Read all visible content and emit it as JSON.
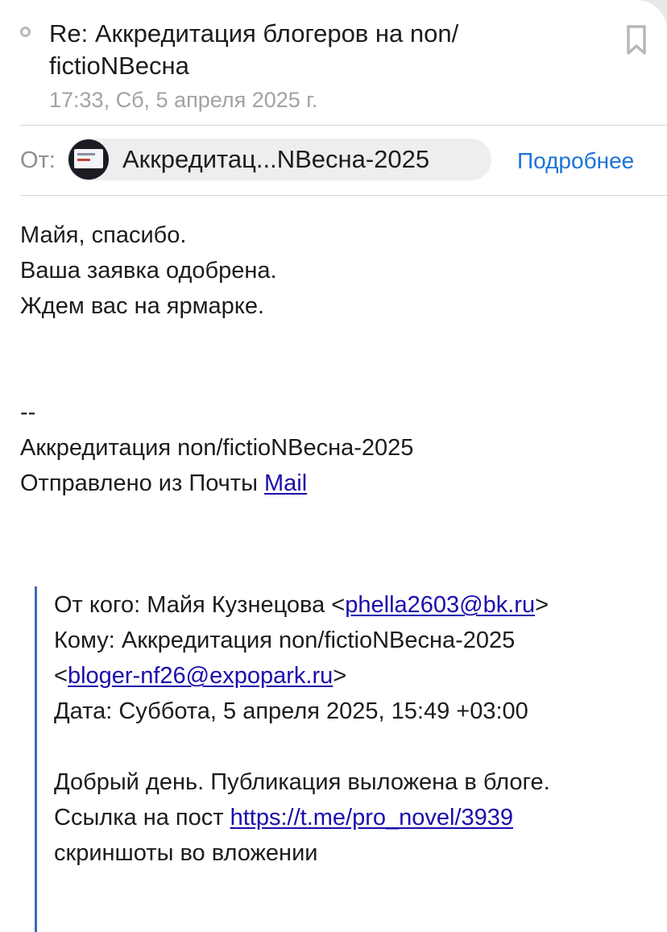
{
  "header": {
    "subject": "Re: Аккредитация блогеров на non/ fictioNВесна",
    "date": "17:33, Сб, 5 апреля 2025 г."
  },
  "from_row": {
    "label": "От:",
    "sender_name": "Аккредитац...NВесна-2025",
    "details_link": "Подробнее"
  },
  "body": {
    "lines": [
      "Майя, спасибо.",
      "Ваша заявка одобрена.",
      "Ждем вас на ярмарке."
    ],
    "signature": {
      "dash": "--",
      "name": "Аккредитация non/fictioNВесна-2025",
      "sent_prefix": "Отправлено из Почты ",
      "sent_link": "Mail"
    }
  },
  "quoted": {
    "from_prefix": "От кого: Майя Кузнецова <",
    "from_email": "phella2603@bk.ru",
    "from_suffix": ">",
    "to_line": "Кому: Аккредитация non/fictioNВесна-2025",
    "to_prefix": "<",
    "to_email": "bloger-nf26@expopark.ru",
    "to_suffix": ">",
    "date_line": "Дата: Суббота, 5 апреля 2025, 15:49 +03:00",
    "greeting": "Добрый день. Публикация выложена в блоге.",
    "post_prefix": "Ссылка на пост ",
    "post_link": "https://t.me/pro_novel/3939",
    "attachments_note": "скриншоты во вложении"
  },
  "colors": {
    "link_blue": "#1a73d9",
    "hyperlink": "#1a0dab",
    "quote_bar": "#3f67b8",
    "secondary_text": "#8e8e93"
  },
  "icons": {
    "unread_indicator": "unread-dot-icon",
    "bookmark": "bookmark-icon",
    "avatar": "sender-avatar"
  }
}
